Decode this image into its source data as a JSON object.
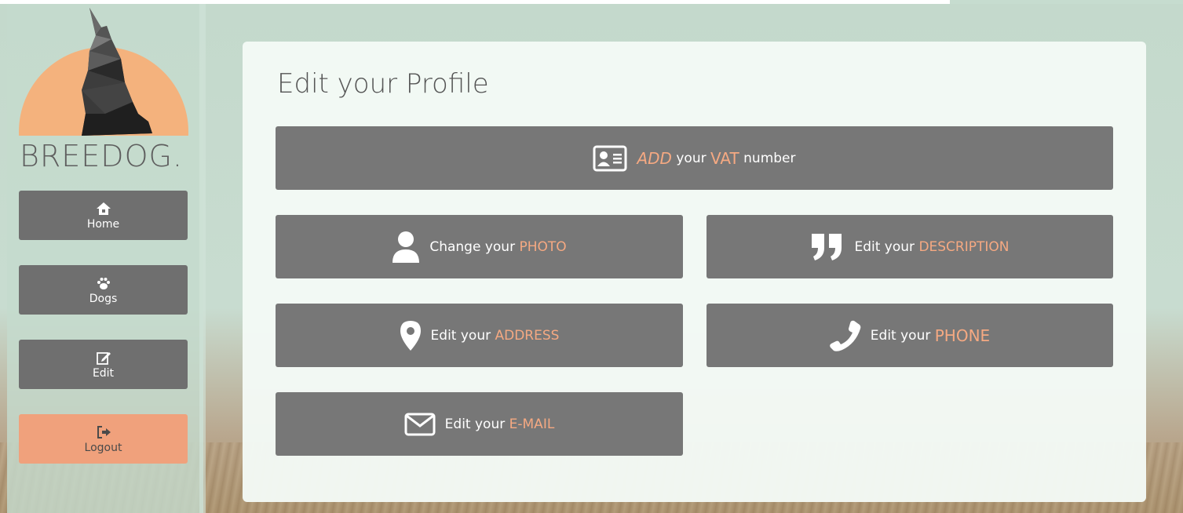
{
  "brand": {
    "name": "BREEDOG."
  },
  "sidebar": {
    "items": [
      {
        "label": "Home",
        "icon": "home-icon"
      },
      {
        "label": "Dogs",
        "icon": "paw-icon"
      },
      {
        "label": "Edit",
        "icon": "edit-icon"
      },
      {
        "label": "Logout",
        "icon": "logout-icon"
      }
    ]
  },
  "main": {
    "title": "Edit your Profile",
    "actions": {
      "vat": {
        "pre": "ADD",
        "mid": " your ",
        "hl": "VAT",
        "post": " number",
        "icon": "id-card-icon"
      },
      "photo": {
        "pre": "Change your ",
        "hl": "PHOTO",
        "icon": "user-icon"
      },
      "description": {
        "pre": "Edit your ",
        "hl": "DESCRIPTION",
        "icon": "quote-icon"
      },
      "address": {
        "pre": "Edit your ",
        "hl": "ADDRESS",
        "icon": "map-marker-icon"
      },
      "phone": {
        "pre": "Edit your ",
        "hl": "PHONE",
        "icon": "phone-icon"
      },
      "email": {
        "pre": "Edit your ",
        "hl": "E-MAIL",
        "icon": "envelope-icon"
      }
    }
  },
  "colors": {
    "accent": "#f5a982",
    "button": "#777777",
    "logout": "#f0a17c",
    "sun": "#f4b27d"
  }
}
